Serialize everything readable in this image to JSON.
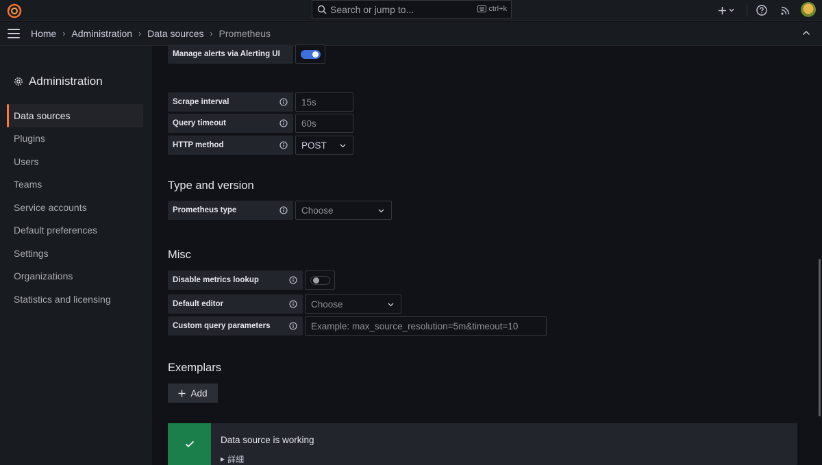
{
  "topbar": {
    "search_placeholder": "Search or jump to...",
    "search_shortcut": "ctrl+k"
  },
  "breadcrumb": {
    "items": [
      "Home",
      "Administration",
      "Data sources",
      "Prometheus"
    ]
  },
  "sidebar": {
    "title": "Administration",
    "items": [
      {
        "label": "Data sources",
        "active": true
      },
      {
        "label": "Plugins"
      },
      {
        "label": "Users"
      },
      {
        "label": "Teams"
      },
      {
        "label": "Service accounts"
      },
      {
        "label": "Default preferences"
      },
      {
        "label": "Settings"
      },
      {
        "label": "Organizations"
      },
      {
        "label": "Statistics and licensing"
      }
    ]
  },
  "form": {
    "manage_alerts": {
      "label": "Manage alerts via Alerting UI",
      "enabled": true
    },
    "scrape_interval": {
      "label": "Scrape interval",
      "placeholder": "15s"
    },
    "query_timeout": {
      "label": "Query timeout",
      "placeholder": "60s"
    },
    "http_method": {
      "label": "HTTP method",
      "value": "POST"
    },
    "type_version": {
      "heading": "Type and version",
      "prometheus_type": {
        "label": "Prometheus type",
        "placeholder": "Choose"
      }
    },
    "misc": {
      "heading": "Misc",
      "disable_metrics_lookup": {
        "label": "Disable metrics lookup",
        "enabled": false
      },
      "default_editor": {
        "label": "Default editor",
        "placeholder": "Choose"
      },
      "custom_query_parameters": {
        "label": "Custom query parameters",
        "placeholder": "Example: max_source_resolution=5m&timeout=10"
      }
    },
    "exemplars": {
      "heading": "Exemplars",
      "add_label": "Add"
    }
  },
  "status": {
    "title": "Data source is working",
    "details_label": "詳細",
    "color": "#1a7f4b"
  },
  "colors": {
    "accent": "#ff7837",
    "toggle_on": "#3d71d9"
  }
}
